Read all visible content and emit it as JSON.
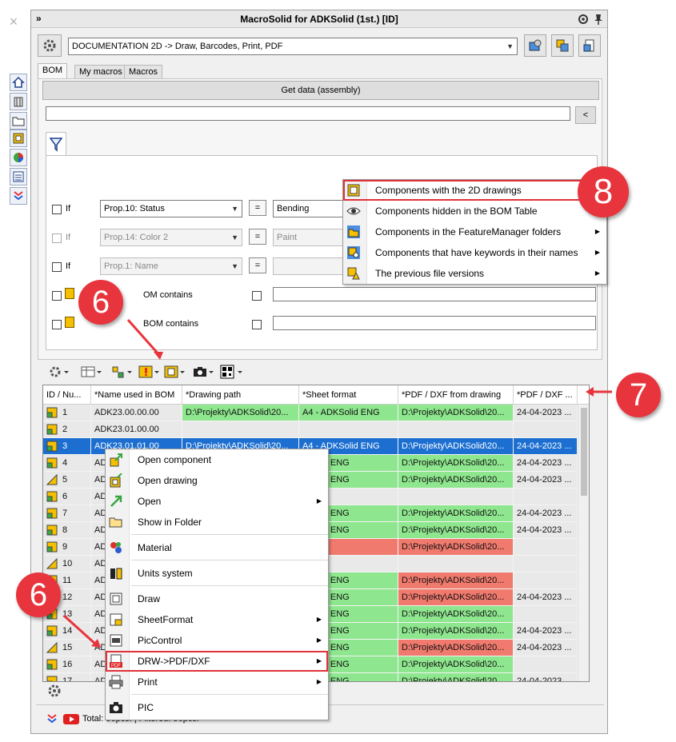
{
  "window": {
    "title": "MacroSolid for ADKSolid (1st.) [ID]",
    "collapse_glyph": "»"
  },
  "macro_select": {
    "value": "DOCUMENTATION 2D -> Draw, Barcodes, Print, PDF"
  },
  "tabs": [
    "BOM",
    "My macros",
    "Macros"
  ],
  "get_data_label": "Get data (assembly)",
  "back_label": "<",
  "filters": [
    {
      "if": "If",
      "prop": "Prop.10: Status",
      "op": "=",
      "value": "Bending",
      "enabled": true
    },
    {
      "if": "If",
      "prop": "Prop.14: Color 2",
      "op": "=",
      "value": "Paint",
      "enabled": false
    },
    {
      "if": "If",
      "prop": "Prop.1: Name",
      "op": "=",
      "value": "",
      "enabled": false
    }
  ],
  "bom_contains": [
    {
      "label": "OM contains"
    },
    {
      "label": "BOM contains"
    }
  ],
  "grid": {
    "columns": [
      "ID / Nu...",
      "*Name used in BOM",
      "*Drawing path",
      "*Sheet format",
      "*PDF / DXF from drawing",
      "*PDF / DXF ..."
    ],
    "rows": [
      {
        "id": "1",
        "name": "ADK23.00.00.00",
        "drawing": "D:\\Projekty\\ADKSolid\\20...",
        "sheet": "A4 - ADKSolid ENG",
        "pdf": "D:\\Projekty\\ADKSolid\\20...",
        "date": "24-04-2023 ..."
      },
      {
        "id": "2",
        "name": "ADK23.01.00.00",
        "drawing": "",
        "sheet": "",
        "pdf": "",
        "date": ""
      },
      {
        "id": "3",
        "name": "ADK23.01.01.00",
        "drawing": "D:\\Projekty\\ADKSolid\\20...",
        "sheet": "A4 - ADKSolid ENG",
        "pdf": "D:\\Projekty\\ADKSolid\\20...",
        "date": "24-04-2023 ..."
      },
      {
        "id": "4",
        "name": "AD",
        "drawing": "",
        "sheet": "KSolid ENG",
        "pdf": "D:\\Projekty\\ADKSolid\\20...",
        "date": "24-04-2023 ..."
      },
      {
        "id": "5",
        "name": "AD",
        "drawing": "",
        "sheet": "KSolid ENG",
        "pdf": "D:\\Projekty\\ADKSolid\\20...",
        "date": "24-04-2023 ..."
      },
      {
        "id": "6",
        "name": "AD",
        "drawing": "",
        "sheet": "",
        "pdf": "",
        "date": ""
      },
      {
        "id": "7",
        "name": "AD",
        "drawing": "",
        "sheet": "KSolid ENG",
        "pdf": "D:\\Projekty\\ADKSolid\\20...",
        "date": "24-04-2023 ..."
      },
      {
        "id": "8",
        "name": "AD",
        "drawing": "",
        "sheet": "KSolid ENG",
        "pdf": "D:\\Projekty\\ADKSolid\\20...",
        "date": "24-04-2023 ..."
      },
      {
        "id": "9",
        "name": "AD",
        "drawing": "",
        "sheet": "ksolid",
        "pdf": "D:\\Projekty\\ADKSolid\\20...",
        "date": ""
      },
      {
        "id": "10",
        "name": "AD",
        "drawing": "",
        "sheet": "",
        "pdf": "",
        "date": ""
      },
      {
        "id": "11",
        "name": "AD",
        "drawing": "",
        "sheet": "KSolid ENG",
        "pdf": "D:\\Projekty\\ADKSolid\\20...",
        "date": ""
      },
      {
        "id": "12",
        "name": "AD",
        "drawing": "",
        "sheet": "KSolid ENG",
        "pdf": "D:\\Projekty\\ADKSolid\\20...",
        "date": "24-04-2023 ..."
      },
      {
        "id": "13",
        "name": "AD",
        "drawing": "",
        "sheet": "KSolid ENG",
        "pdf": "D:\\Projekty\\ADKSolid\\20...",
        "date": ""
      },
      {
        "id": "14",
        "name": "AD",
        "drawing": "",
        "sheet": "KSolid ENG",
        "pdf": "D:\\Projekty\\ADKSolid\\20...",
        "date": "24-04-2023 ..."
      },
      {
        "id": "15",
        "name": "AD",
        "drawing": "",
        "sheet": "KSolid ENG",
        "pdf": "D:\\Projekty\\ADKSolid\\20...",
        "date": "24-04-2023 ..."
      },
      {
        "id": "16",
        "name": "AD",
        "drawing": "",
        "sheet": "KSolid ENG",
        "pdf": "D:\\Projekty\\ADKSolid\\20...",
        "date": ""
      },
      {
        "id": "17",
        "name": "AD",
        "drawing": "",
        "sheet": "KSolid ENG",
        "pdf": "D:\\Projekty\\ADKSolid\\20...",
        "date": "24-04-2023 ..."
      }
    ]
  },
  "context_menu": [
    "Open component",
    "Open drawing",
    "Open",
    "Show in Folder",
    "Material",
    "Units system",
    "Draw",
    "SheetFormat",
    "PicControl",
    "DRW->PDF/DXF",
    "Print",
    "PIC"
  ],
  "dropdown_menu": [
    "Components with the 2D drawings",
    "Components hidden in the BOM Table",
    "Components in the FeatureManager folders",
    "Components that have keywords in their names",
    "The previous file versions"
  ],
  "status": {
    "text": "Total: 56pcs. | Filtered: 56pcs."
  },
  "callouts": {
    "a": "6",
    "b": "6",
    "c": "7",
    "d": "8"
  },
  "colors": {
    "accent_red": "#e8343c",
    "selection": "#1c6fd1",
    "ok_green": "#8ee68e",
    "missing_red": "#f07a6e"
  }
}
